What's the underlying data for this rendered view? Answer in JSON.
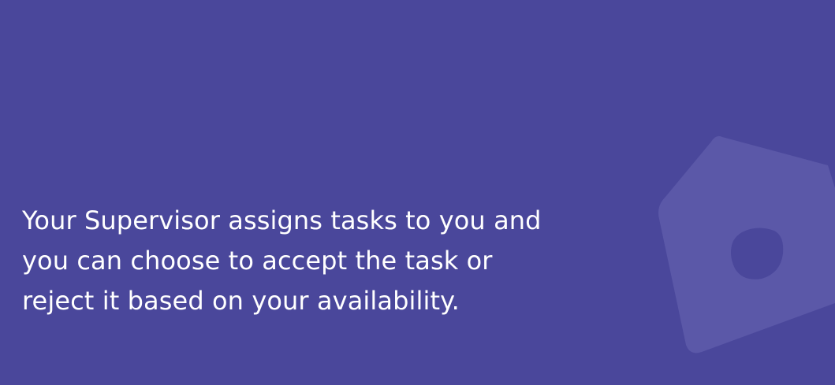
{
  "onboarding": {
    "description_lines": [
      "Your Supervisor assigns tasks to you and",
      "you can choose to accept the task or",
      "reject it based on your availability."
    ]
  },
  "decoration": {
    "icon": "pentagon-shape-icon",
    "shape_color": "#5b58a8",
    "hole_color": "#4a479b"
  },
  "theme": {
    "background": "#4a479b",
    "text_color": "#ffffff"
  }
}
